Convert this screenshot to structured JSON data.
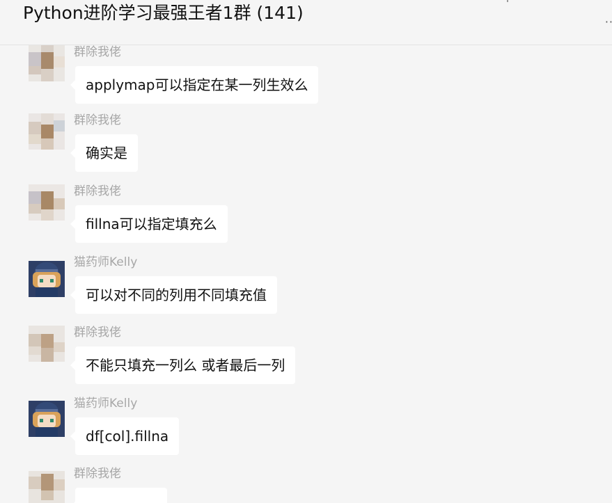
{
  "header": {
    "title": "Python进阶学习最强王者1群 (141)",
    "more_icon": "more-dots-icon"
  },
  "messages": [
    {
      "sender": "群除我佬",
      "text": "applymap可以指定在某一列生效么",
      "avatar": "mosaic-avatar"
    },
    {
      "sender": "群除我佬",
      "text": "确实是",
      "avatar": "mosaic-avatar"
    },
    {
      "sender": "群除我佬",
      "text": "fillna可以指定填充么",
      "avatar": "mosaic-avatar"
    },
    {
      "sender": "猫药师Kelly",
      "text": "可以对不同的列用不同填充值",
      "avatar": "cartoon-avatar"
    },
    {
      "sender": "群除我佬",
      "text": "不能只填充一列么 或者最后一列",
      "avatar": "mosaic-avatar"
    },
    {
      "sender": "猫药师Kelly",
      "text": "df[col].fillna",
      "avatar": "cartoon-avatar"
    },
    {
      "sender": "群除我佬",
      "text": "",
      "avatar": "mosaic-avatar"
    }
  ]
}
